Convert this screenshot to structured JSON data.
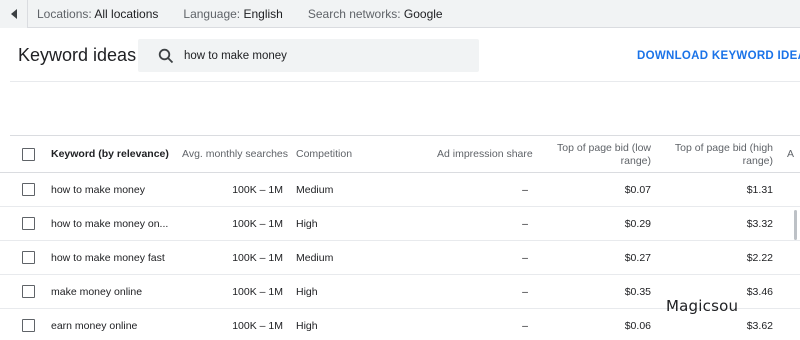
{
  "filters": {
    "locations_label": "Locations:",
    "locations_value": "All locations",
    "language_label": "Language:",
    "language_value": "English",
    "networks_label": "Search networks:",
    "networks_value": "Google"
  },
  "header": {
    "title": "Keyword ideas",
    "search_query": "how to make money",
    "download_label": "DOWNLOAD KEYWORD IDEAS"
  },
  "table": {
    "columns": {
      "keyword": "Keyword (by relevance)",
      "avg": "Avg. monthly searches",
      "competition": "Competition",
      "impression": "Ad impression share",
      "bid_low_1": "Top of page bid (low",
      "bid_low_2": "range)",
      "bid_high_1": "Top of page bid (high",
      "bid_high_2": "range)",
      "more": "A"
    },
    "rows": [
      {
        "keyword": "how to make money",
        "avg": "100K – 1M",
        "competition": "Medium",
        "impression": "–",
        "bid_low": "$0.07",
        "bid_high": "$1.31"
      },
      {
        "keyword": "how to make money on...",
        "avg": "100K – 1M",
        "competition": "High",
        "impression": "–",
        "bid_low": "$0.29",
        "bid_high": "$3.32"
      },
      {
        "keyword": "how to make money fast",
        "avg": "100K – 1M",
        "competition": "Medium",
        "impression": "–",
        "bid_low": "$0.27",
        "bid_high": "$2.22"
      },
      {
        "keyword": "make money online",
        "avg": "100K – 1M",
        "competition": "High",
        "impression": "–",
        "bid_low": "$0.35",
        "bid_high": "$3.46"
      },
      {
        "keyword": "earn money online",
        "avg": "100K – 1M",
        "competition": "High",
        "impression": "–",
        "bid_low": "$0.06",
        "bid_high": "$3.62"
      }
    ]
  },
  "icons": {
    "back": "chevron-left-icon",
    "search": "search-icon",
    "checkbox": "checkbox-icon"
  },
  "colors": {
    "accent": "#1a73e8",
    "filter_bar": "#f1f3f4"
  },
  "watermark": "Magicsou"
}
